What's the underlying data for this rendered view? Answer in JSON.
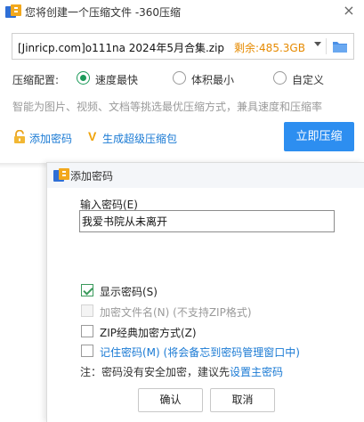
{
  "main_window": {
    "title": "您将创建一个压缩文件 -360压缩",
    "close_glyph": "×",
    "archive_path": "[Jinricp.com]o111na 2024年5月合集.zip",
    "free_space": "剩余:485.3GB",
    "config_label": "压缩配置:",
    "options": [
      {
        "label": "速度最快",
        "selected": true
      },
      {
        "label": "体积最小",
        "selected": false
      },
      {
        "label": "自定义",
        "selected": false
      }
    ],
    "hint": "智能为图片、视频、文档等挑选最优压缩方式，兼具速度和压缩率",
    "add_password_link": "添加密码",
    "sfx_link": "生成超级压缩包",
    "compress_button": "立即压缩"
  },
  "password_dialog": {
    "title": "添加密码",
    "input_label": "输入密码(E)",
    "password_value": "我爱书院从未离开",
    "checkboxes": [
      {
        "label": "显示密码(S)",
        "checked": true,
        "disabled": false
      },
      {
        "label": "加密文件名(N) (不支持ZIP格式)",
        "checked": false,
        "disabled": true
      },
      {
        "label": "ZIP经典加密方式(Z)",
        "checked": false,
        "disabled": false
      },
      {
        "label": "记住密码(M) (将会备忘到密码管理窗口中)",
        "checked": false,
        "disabled": false
      }
    ],
    "note_prefix": "注：密码没有安全加密，建议先",
    "note_link": "设置主密码",
    "ok_button": "确认",
    "cancel_button": "取消"
  },
  "colors": {
    "accent_blue": "#2d8ef0",
    "link_blue": "#1a7ad4",
    "radio_green": "#1b9a59",
    "free_space_orange": "#e68a00"
  },
  "icons": {
    "app": "360-zip-icon",
    "folder": "folder-icon",
    "lock": "lock-icon",
    "sfx": "v-badge-icon"
  }
}
